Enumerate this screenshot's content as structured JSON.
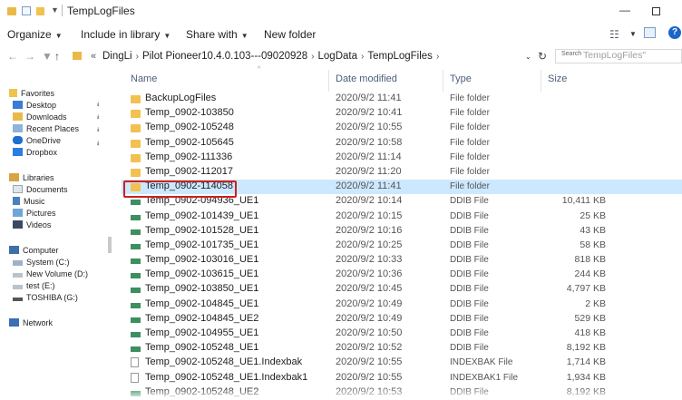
{
  "window": {
    "title": "TempLogFiles",
    "minimize_glyph": "—"
  },
  "ribbon": {
    "organize": "Organize",
    "include": "Include in library",
    "share": "Share with",
    "new_folder": "New folder",
    "caret": "▼"
  },
  "address": {
    "back": "←",
    "forward": "→",
    "up": "↑",
    "overflow": "«",
    "crumbs": [
      "DingLi",
      "Pilot Pioneer10.4.0.103---09020928",
      "LogData",
      "TempLogFiles"
    ],
    "crumb_sep": "›",
    "dropdown": "⌄",
    "refresh": "↻",
    "search_label": "Search",
    "search_placeholder": "TempLogFiles\""
  },
  "nav": {
    "favorites": "Favorites",
    "desktop": "Desktop",
    "downloads": "Downloads",
    "recent": "Recent Places",
    "onedrive": "OneDrive",
    "dropbox": "Dropbox",
    "libraries": "Libraries",
    "documents": "Documents",
    "music": "Music",
    "pictures": "Pictures",
    "videos": "Videos",
    "computer": "Computer",
    "system": "System (C:)",
    "new_volume": "New Volume (D:)",
    "test": "test (E:)",
    "toshiba": "TOSHIBA (G:)",
    "network": "Network",
    "pin": "⯯"
  },
  "columns": {
    "name": "Name",
    "date": "Date modified",
    "type": "Type",
    "size": "Size",
    "sort": "^"
  },
  "files": [
    {
      "name": "BackupLogFiles",
      "date": "2020/9/2 11:41",
      "type": "File folder",
      "size": "",
      "kind": "folder"
    },
    {
      "name": "Temp_0902-103850",
      "date": "2020/9/2 10:41",
      "type": "File folder",
      "size": "",
      "kind": "folder"
    },
    {
      "name": "Temp_0902-105248",
      "date": "2020/9/2 10:55",
      "type": "File folder",
      "size": "",
      "kind": "folder"
    },
    {
      "name": "Temp_0902-105645",
      "date": "2020/9/2 10:58",
      "type": "File folder",
      "size": "",
      "kind": "folder"
    },
    {
      "name": "Temp_0902-111336",
      "date": "2020/9/2 11:14",
      "type": "File folder",
      "size": "",
      "kind": "folder"
    },
    {
      "name": "Temp_0902-112017",
      "date": "2020/9/2 11:20",
      "type": "File folder",
      "size": "",
      "kind": "folder"
    },
    {
      "name": "Temp_0902-114058",
      "date": "2020/9/2 11:41",
      "type": "File folder",
      "size": "",
      "kind": "folder",
      "selected": true
    },
    {
      "name": "Temp_0902-094936_UE1",
      "date": "2020/9/2 10:14",
      "type": "DDIB File",
      "size": "10,411 KB",
      "kind": "ddib"
    },
    {
      "name": "Temp_0902-101439_UE1",
      "date": "2020/9/2 10:15",
      "type": "DDIB File",
      "size": "25 KB",
      "kind": "ddib"
    },
    {
      "name": "Temp_0902-101528_UE1",
      "date": "2020/9/2 10:16",
      "type": "DDIB File",
      "size": "43 KB",
      "kind": "ddib"
    },
    {
      "name": "Temp_0902-101735_UE1",
      "date": "2020/9/2 10:25",
      "type": "DDIB File",
      "size": "58 KB",
      "kind": "ddib"
    },
    {
      "name": "Temp_0902-103016_UE1",
      "date": "2020/9/2 10:33",
      "type": "DDIB File",
      "size": "818 KB",
      "kind": "ddib"
    },
    {
      "name": "Temp_0902-103615_UE1",
      "date": "2020/9/2 10:36",
      "type": "DDIB File",
      "size": "244 KB",
      "kind": "ddib"
    },
    {
      "name": "Temp_0902-103850_UE1",
      "date": "2020/9/2 10:45",
      "type": "DDIB File",
      "size": "4,797 KB",
      "kind": "ddib"
    },
    {
      "name": "Temp_0902-104845_UE1",
      "date": "2020/9/2 10:49",
      "type": "DDIB File",
      "size": "2 KB",
      "kind": "ddib"
    },
    {
      "name": "Temp_0902-104845_UE2",
      "date": "2020/9/2 10:49",
      "type": "DDIB File",
      "size": "529 KB",
      "kind": "ddib"
    },
    {
      "name": "Temp_0902-104955_UE1",
      "date": "2020/9/2 10:50",
      "type": "DDIB File",
      "size": "418 KB",
      "kind": "ddib"
    },
    {
      "name": "Temp_0902-105248_UE1",
      "date": "2020/9/2 10:52",
      "type": "DDIB File",
      "size": "8,192 KB",
      "kind": "ddib"
    },
    {
      "name": "Temp_0902-105248_UE1.Indexbak",
      "date": "2020/9/2 10:55",
      "type": "INDEXBAK File",
      "size": "1,714 KB",
      "kind": "doc"
    },
    {
      "name": "Temp_0902-105248_UE1.Indexbak1",
      "date": "2020/9/2 10:55",
      "type": "INDEXBAK1 File",
      "size": "1,934 KB",
      "kind": "doc"
    },
    {
      "name": "Temp_0902-105248_UE2",
      "date": "2020/9/2 10:53",
      "type": "DDIB File",
      "size": "8,192 KB",
      "kind": "ddib"
    }
  ]
}
